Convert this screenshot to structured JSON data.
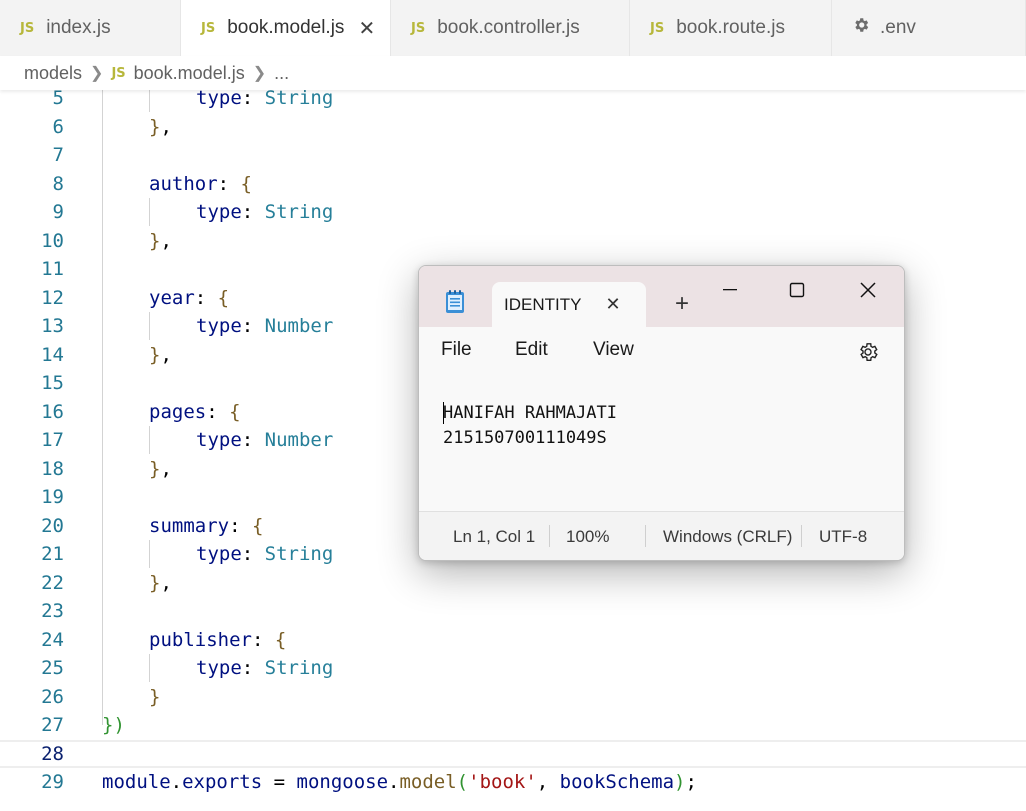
{
  "editor_tabs": [
    {
      "icon": "JS",
      "label": "index.js",
      "active": false
    },
    {
      "icon": "JS",
      "label": "book.model.js",
      "active": true,
      "close": "✕"
    },
    {
      "icon": "JS",
      "label": "book.controller.js",
      "active": false
    },
    {
      "icon": "JS",
      "label": "book.route.js",
      "active": false
    },
    {
      "icon": "gear-icon",
      "label": ".env",
      "active": false
    }
  ],
  "breadcrumb": {
    "folder": "models",
    "file_icon": "JS",
    "file": "book.model.js",
    "more": "..."
  },
  "code": {
    "current_line": 28,
    "lines": [
      {
        "n": "5",
        "html": "<span class='tok-prop'>type</span>: <span class='tok-type'>String</span>"
      },
      {
        "n": "6",
        "html": "<span class='tok-brace'>}</span>,"
      },
      {
        "n": "7",
        "html": ""
      },
      {
        "n": "8",
        "html": "<span class='tok-prop'>author</span>: <span class='tok-brace'>{</span>"
      },
      {
        "n": "9",
        "html": "<span class='tok-prop'>type</span>: <span class='tok-type'>String</span>"
      },
      {
        "n": "10",
        "html": "<span class='tok-brace'>}</span>,"
      },
      {
        "n": "11",
        "html": ""
      },
      {
        "n": "12",
        "html": "<span class='tok-prop'>year</span>: <span class='tok-brace'>{</span>"
      },
      {
        "n": "13",
        "html": "<span class='tok-prop'>type</span>: <span class='tok-type'>Number</span>"
      },
      {
        "n": "14",
        "html": "<span class='tok-brace'>}</span>,"
      },
      {
        "n": "15",
        "html": ""
      },
      {
        "n": "16",
        "html": "<span class='tok-prop'>pages</span>: <span class='tok-brace'>{</span>"
      },
      {
        "n": "17",
        "html": "<span class='tok-prop'>type</span>: <span class='tok-type'>Number</span>"
      },
      {
        "n": "18",
        "html": "<span class='tok-brace'>}</span>,"
      },
      {
        "n": "19",
        "html": ""
      },
      {
        "n": "20",
        "html": "<span class='tok-prop'>summary</span>: <span class='tok-brace'>{</span>"
      },
      {
        "n": "21",
        "html": "<span class='tok-prop'>type</span>: <span class='tok-type'>String</span>"
      },
      {
        "n": "22",
        "html": "<span class='tok-brace'>}</span>,"
      },
      {
        "n": "23",
        "html": ""
      },
      {
        "n": "24",
        "html": "<span class='tok-prop'>publisher</span>: <span class='tok-brace'>{</span>"
      },
      {
        "n": "25",
        "html": "<span class='tok-prop'>type</span>: <span class='tok-type'>String</span>"
      },
      {
        "n": "26",
        "html": "<span class='tok-brace'>}</span>"
      },
      {
        "n": "27",
        "html": "<span class='tok-brace-outer'>})</span>"
      },
      {
        "n": "28",
        "html": ""
      },
      {
        "n": "29",
        "html": "<span class='tok-prop'>module</span>.<span class='tok-prop'>exports</span> = <span class='tok-prop'>mongoose</span>.<span class='tok-fn'>model</span><span class='tok-brace-outer'>(</span><span class='tok-str'>'book'</span>, <span class='tok-prop'>bookSchema</span><span class='tok-brace-outer'>)</span>;"
      }
    ]
  },
  "notepad": {
    "app_icon": "notepad-icon",
    "tab_title": "IDENTITY",
    "tab_close": "✕",
    "new_tab": "+",
    "menu": {
      "file": "File",
      "edit": "Edit",
      "view": "View"
    },
    "content_line1": "HANIFAH RAHMAJATI",
    "content_line2": "215150700111049S",
    "status": {
      "position": "Ln 1, Col 1",
      "zoom": "100%",
      "line_ending": "Windows (CRLF)",
      "encoding": "UTF-8"
    }
  }
}
